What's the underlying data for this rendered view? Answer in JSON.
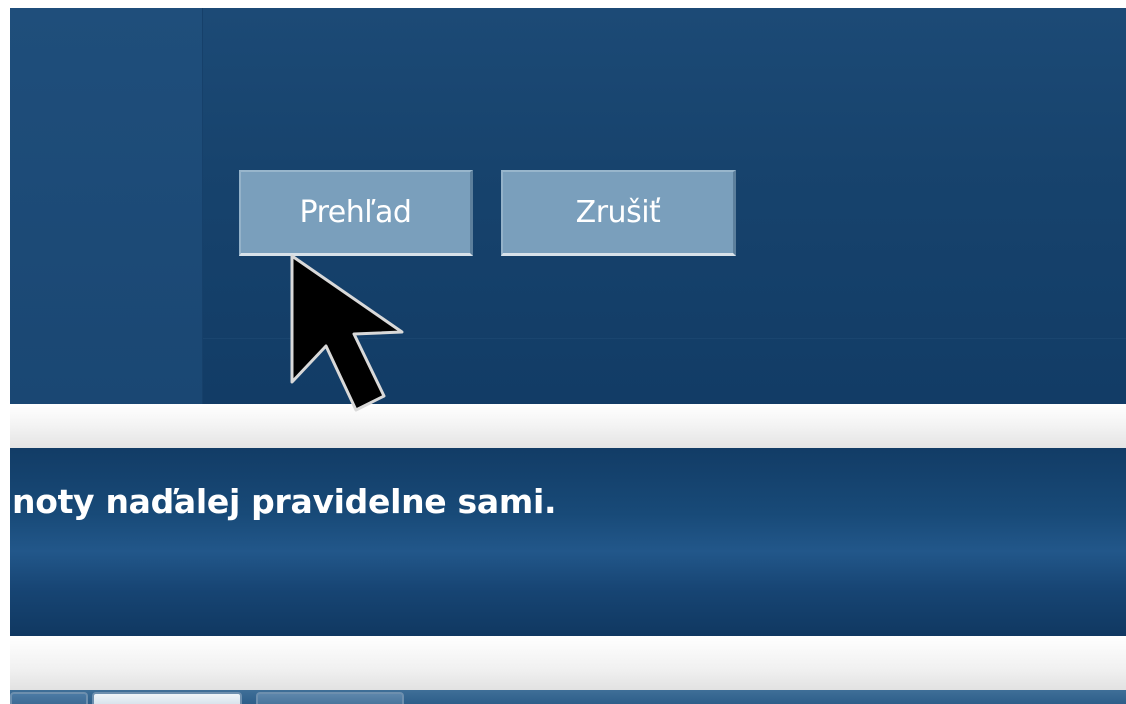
{
  "dialog": {
    "buttons": {
      "overview_label": "Prehľad",
      "cancel_label": "Zrušiť"
    }
  },
  "banner": {
    "text": "noty naďalej pravidelne sami."
  },
  "cursor": {
    "icon": "arrow-cursor-icon"
  },
  "colors": {
    "dialog_background": "#17436d",
    "button_background": "#7a9fbc",
    "banner_background": "#184a78"
  }
}
